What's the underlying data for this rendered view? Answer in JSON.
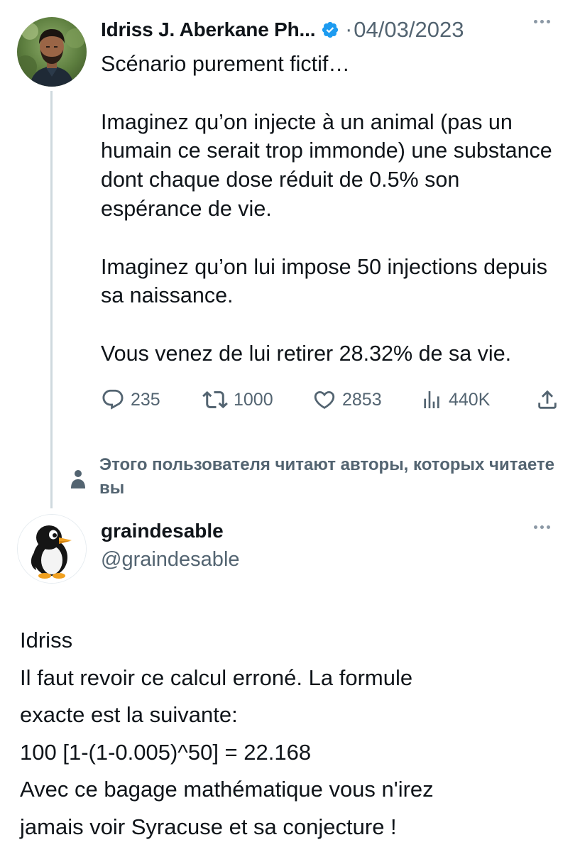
{
  "original_tweet": {
    "author_name": "Idriss J. Aberkane Ph...",
    "verified_icon": "verified-badge-icon",
    "date_separator": "·",
    "date": "04/03/2023",
    "more_icon": "more-options-icon",
    "paragraphs": [
      "Scénario purement fictif…",
      "Imaginez qu’on injecte à un animal (pas un humain ce serait trop immonde) une substance dont chaque dose réduit de 0.5% son espérance de vie.",
      "Imaginez qu’on lui impose 50 injections depuis sa naissance.",
      "Vous venez de lui retirer 28.32% de sa vie."
    ],
    "actions": {
      "replies": "235",
      "retweets": "1000",
      "likes": "2853",
      "views": "440K",
      "icons": [
        "reply-icon",
        "retweet-icon",
        "like-icon",
        "views-icon",
        "share-icon"
      ]
    }
  },
  "social_context": {
    "icon": "person-icon",
    "text": "Этого пользователя читают авторы, которых читаете вы"
  },
  "reply": {
    "name": "graindesable",
    "handle": "@graindesable",
    "more_icon": "more-options-icon",
    "lines": [
      "Idriss",
      "Il faut revoir ce calcul erroné.  La formule",
      "exacte est la suivante:",
      "100 [1-(1-0.005)^50] = 22.168",
      "Avec ce bagage mathématique vous n'irez",
      "jamais voir Syracuse et sa conjecture !"
    ]
  },
  "colors": {
    "text": "#0f1419",
    "secondary": "#536471",
    "verified": "#1d9bf0",
    "thread_line": "#cfd9de"
  }
}
